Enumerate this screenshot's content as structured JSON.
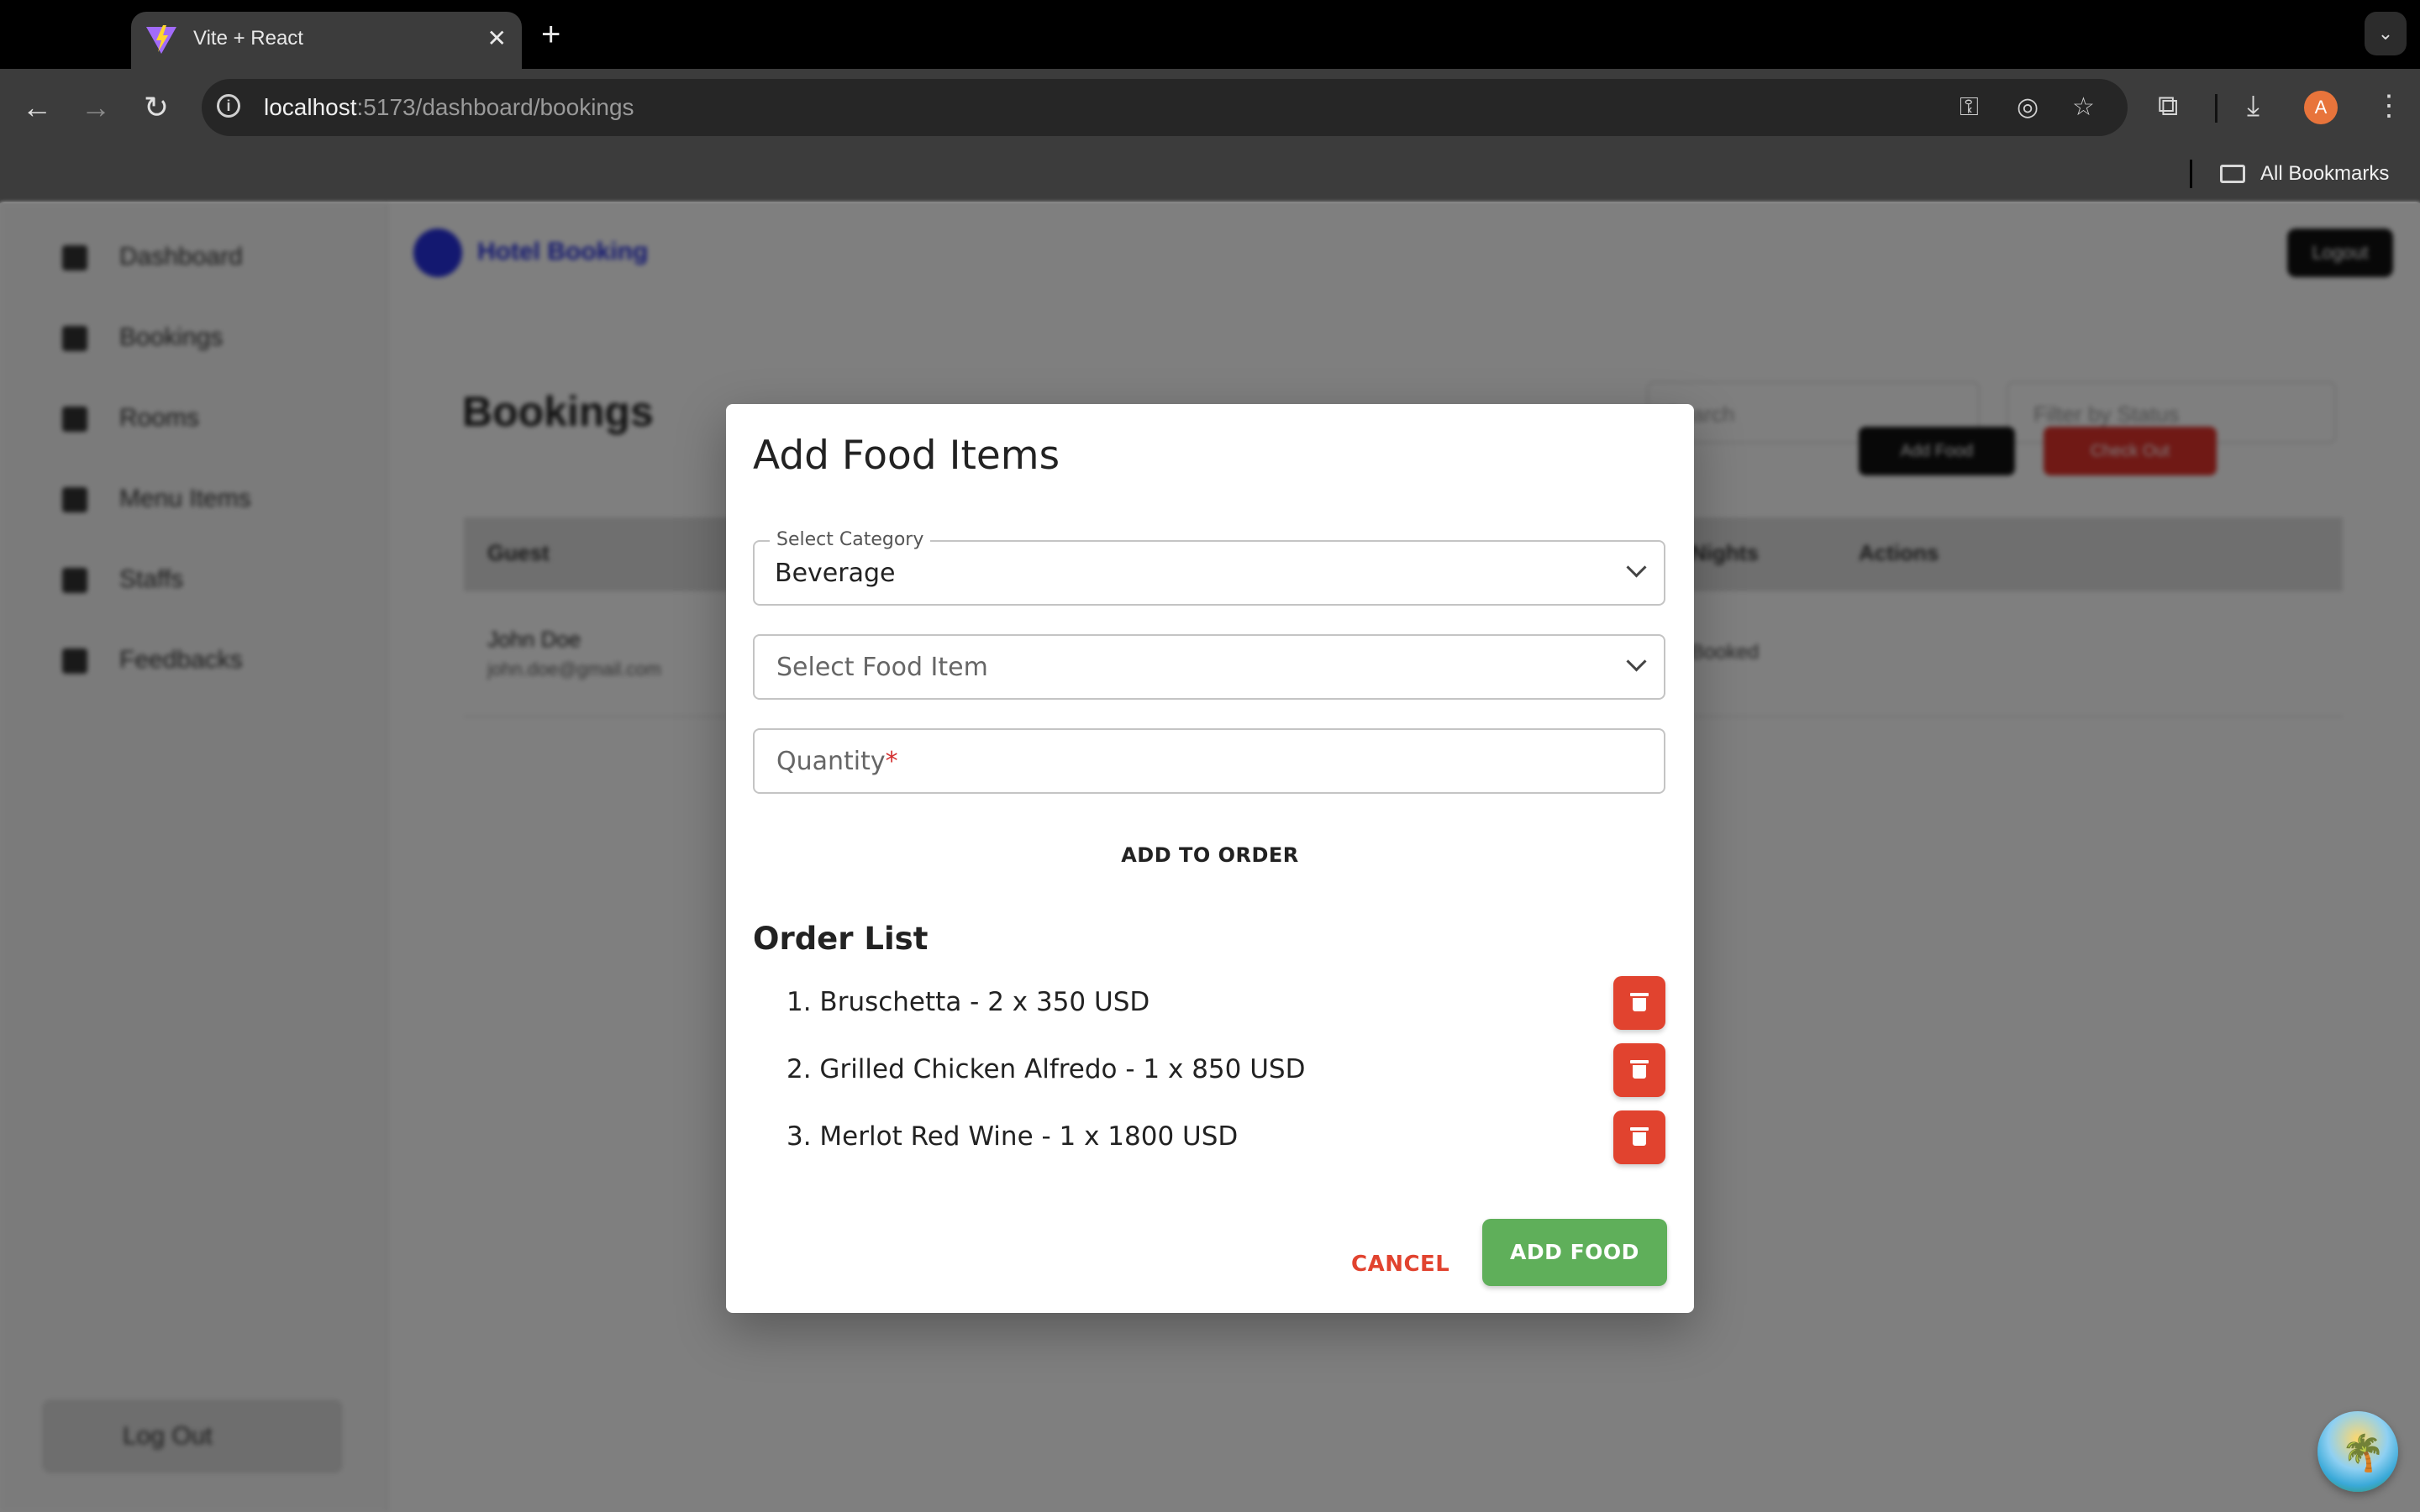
{
  "browser": {
    "tab_title": "Vite + React",
    "url_host": "localhost",
    "url_path": ":5173/dashboard/bookings",
    "bookmarks_label": "All Bookmarks",
    "profile_initial": "A"
  },
  "sidebar": {
    "items": [
      {
        "label": "Dashboard"
      },
      {
        "label": "Bookings"
      },
      {
        "label": "Rooms"
      },
      {
        "label": "Menu Items"
      },
      {
        "label": "Staffs"
      },
      {
        "label": "Feedbacks"
      }
    ],
    "logout_label": "Log Out"
  },
  "header": {
    "title": "Hotel Booking",
    "button": "Logout"
  },
  "page": {
    "title": "Bookings",
    "search_placeholder": "Search",
    "filter_placeholder": "Filter by Status",
    "columns": [
      "Guest",
      "Nights",
      "Actions"
    ],
    "rows": [
      {
        "name": "John Doe",
        "email": "john.doe@gmail.com",
        "nights": "Booked",
        "btn1": "Add Food",
        "btn2": "Check Out"
      }
    ]
  },
  "modal": {
    "title": "Add Food Items",
    "category_label": "Select Category",
    "category_value": "Beverage",
    "food_placeholder": "Select Food Item",
    "quantity_placeholder": "Quantity",
    "quantity_required": "*",
    "add_to_order": "ADD TO ORDER",
    "order_list_title": "Order List",
    "order_items": [
      "1. Bruschetta - 2 x 350 USD",
      "2. Grilled Chicken Alfredo - 1 x 850 USD",
      "3. Merlot Red Wine - 1 x 1800 USD"
    ],
    "cancel": "CANCEL",
    "add_food": "ADD FOOD"
  },
  "colors": {
    "primary_green": "#5faf5a",
    "danger_red": "#e1432f",
    "brand_blue": "#2730e0"
  },
  "icons": [
    "vite-icon",
    "close-icon",
    "plus-icon",
    "back-icon",
    "forward-icon",
    "reload-icon",
    "info-icon",
    "key-icon",
    "eye-off-icon",
    "star-icon",
    "extensions-icon",
    "download-icon",
    "menu-icon",
    "folder-icon",
    "chevron-down-icon",
    "trash-icon"
  ]
}
